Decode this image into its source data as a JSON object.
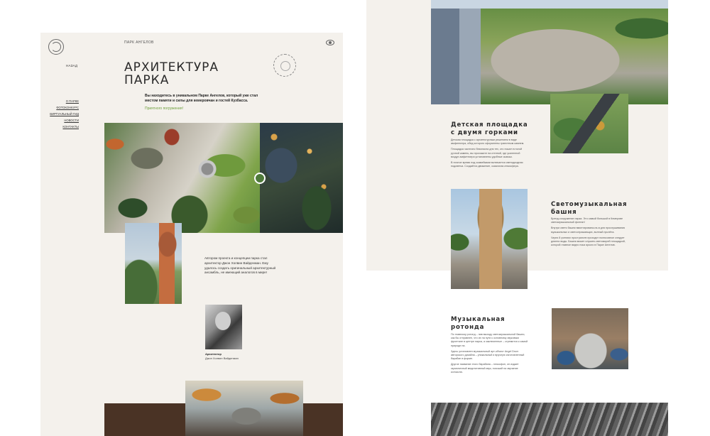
{
  "header": {
    "brand": "ПАРК АНГЕЛОВ"
  },
  "nav": {
    "back": "НАЗАД",
    "items": [
      "О ПАРКЕ",
      "ФОТОКОНКУРС",
      "ВИРТУАЛЬНЫЙ ГИД",
      "НОВОСТИ",
      "КОНТАКТЫ"
    ]
  },
  "hero": {
    "title": "АРХИТЕКТУРА ПАРКА",
    "intro": "Вы находитесь в уникальном Парке Ангелов, который уже стал местом памяти и силы для кемеровчан и гостей Кузбасса.",
    "greeting": "Приятного погружения!"
  },
  "authors": {
    "text": "Автором проекта и концепции парка стал архитектор Джон Холвин Вайденман. Ему удалось создать оригинальный архитектурный ансамбль, не имеющий аналогов в мире!",
    "caption_role": "Архитектор",
    "caption_name": "Джон Холвин Вайденман"
  },
  "sections": {
    "playground": {
      "title": "Детская площадка с двумя горками",
      "paragraphs": [
        "Детская площадка с архитектурным решением в виде амфитеатра, обед которого оформлены гранитным камнем.",
        "Площадка частично безопасна для тех, кто пошел в ногой ручной камень, вы прохожите на стенной, где усиленной воздух амфитеатра установлены удобные скамьи.",
        "В ночное время под скамейками включается светодиодная подсветка. Создаётся движение, сказочная атмосфера."
      ]
    },
    "tower": {
      "title": "Светомузыкальная башня",
      "paragraphs": [
        "Бренд-сооружение парка. Это самый большой в Кемерове светомузыкальный фонтан!",
        "Внутри светя башни вмонтирована-на-в для прослушивания музыкальных и светоотражающих, волный пролёта.",
        "Через 8 учениях пространств проходит полюсовное следует длинно воды. Башня может служить светоморей площадкой, которой главное видно пока яркого в Парке Ангелов."
      ]
    },
    "rotonda": {
      "title": "Музыкальная ротонда",
      "paragraphs": [
        "По главному ротонд – пав выходу светомузыкальной башни, как бы отправлен, что их на пути к основному звуковым фронтале в центре парка, а заключенные – стремится к самой природе на.",
        "Здесь установлен музыкальный арт-объект Angel Drum авторского дизайна – уникальный и вручную изготовленный барабан в форме.",
        "Другое название этого барабана – глюкофон, он издает гармоничный медитативный звук, похожий на звучание колокола."
      ]
    }
  }
}
